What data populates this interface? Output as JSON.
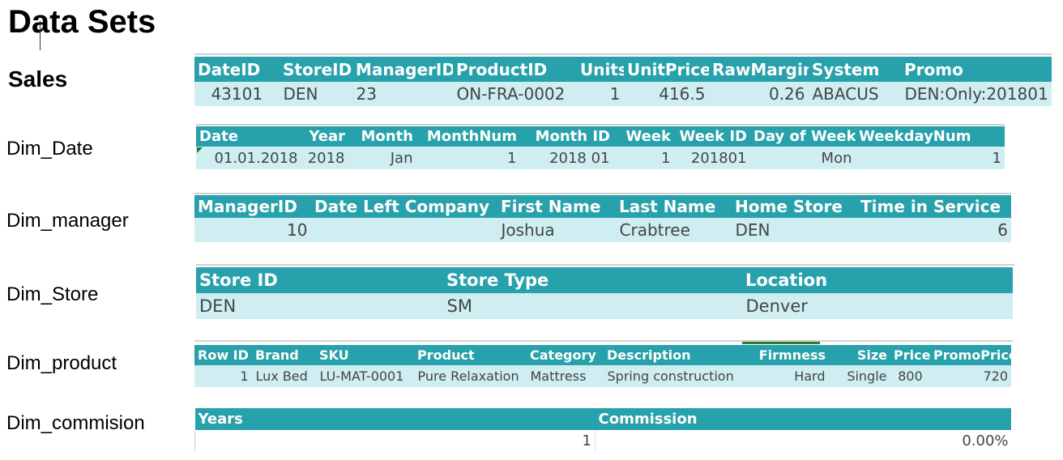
{
  "page_title": "Data Sets",
  "sections": {
    "sales": {
      "label": "Sales",
      "headers": [
        "DateID",
        "StoreID",
        "ManagerID",
        "ProductID",
        "Units",
        "UnitPrice",
        "RawMargin",
        "System",
        "Promo"
      ],
      "row": [
        "43101",
        "DEN",
        "23",
        "ON-FRA-0002",
        "1",
        "416.5",
        "0.26",
        "ABACUS",
        "DEN:Only:201801"
      ]
    },
    "dim_date": {
      "label": "Dim_Date",
      "headers": [
        "Date",
        "Year",
        "Month",
        "MonthNum",
        "Month ID",
        "Week",
        "Week ID",
        "Day of Week",
        "WeekdayNum"
      ],
      "row": [
        "01.01.2018",
        "2018",
        "Jan",
        "1",
        "2018 01",
        "1",
        "201801",
        "Mon",
        "1"
      ]
    },
    "dim_manager": {
      "label": "Dim_manager",
      "headers": [
        "ManagerID",
        "Date Left Company",
        "First Name",
        "Last Name",
        "Home Store",
        "Time in Service"
      ],
      "row": [
        "10",
        "",
        "Joshua",
        "Crabtree",
        "DEN",
        "6"
      ]
    },
    "dim_store": {
      "label": "Dim_Store",
      "headers": [
        "Store ID",
        "Store Type",
        "Location"
      ],
      "row": [
        "DEN",
        "SM",
        "Denver"
      ]
    },
    "dim_product": {
      "label": "Dim_product",
      "headers": [
        "Row ID",
        "Brand",
        "SKU",
        "Product",
        "Category",
        "Description",
        "Firmness",
        "Size",
        "Price",
        "PromoPrice"
      ],
      "row": [
        "1",
        "Lux Bed",
        "LU-MAT-0001",
        "Pure Relaxation",
        "Mattress",
        "Spring construction",
        "Hard",
        "Single",
        "800",
        "720"
      ]
    },
    "dim_commision": {
      "label": "Dim_commision",
      "headers": [
        "Years",
        "Commission"
      ],
      "row": [
        "1",
        "0.00%"
      ]
    }
  },
  "colors": {
    "header_bg": "#27a1ab",
    "row_bg": "#cfeef2",
    "header_text": "#ffffff",
    "cell_text": "#444444"
  }
}
